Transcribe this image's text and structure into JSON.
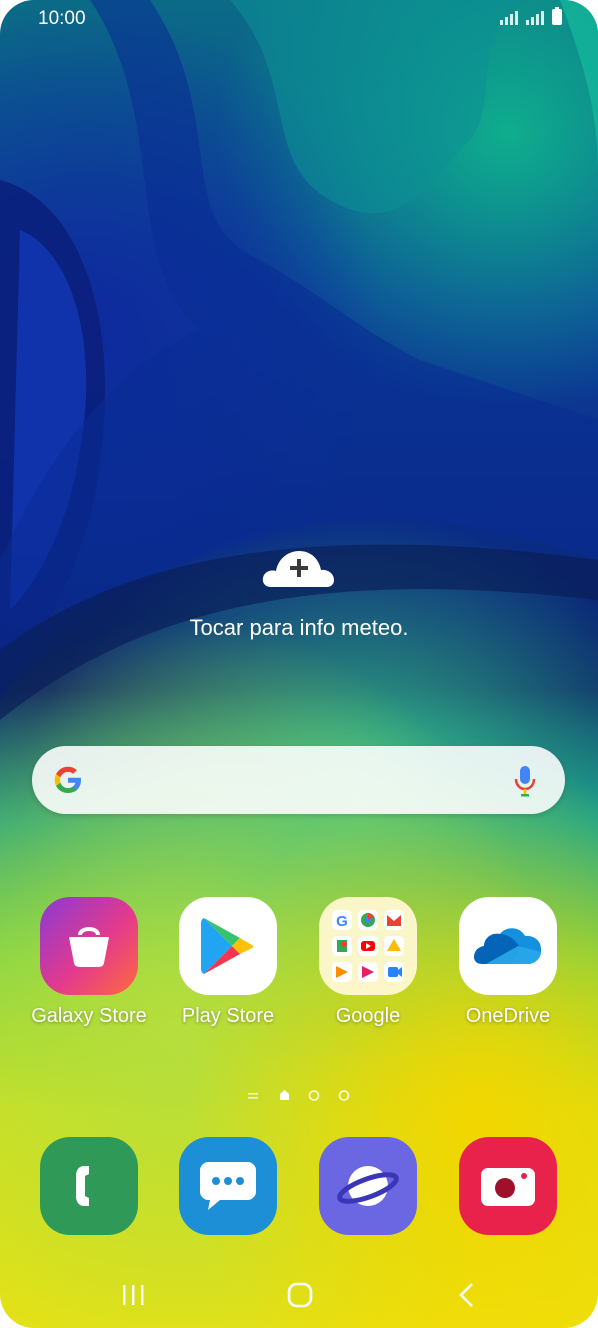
{
  "status_bar": {
    "time": "10:00"
  },
  "weather": {
    "label": "Tocar para info meteo.",
    "icon": "cloud-plus-icon"
  },
  "search": {
    "logo": "google-g-icon",
    "mic_icon": "mic-icon"
  },
  "apps": [
    {
      "label": "Galaxy Store",
      "icon": "galaxy-store-icon"
    },
    {
      "label": "Play Store",
      "icon": "play-store-icon"
    },
    {
      "label": "Google",
      "icon": "google-folder-icon"
    },
    {
      "label": "OneDrive",
      "icon": "onedrive-icon"
    }
  ],
  "page_indicator": {
    "pages": 3,
    "current": 1
  },
  "dock": [
    {
      "icon": "phone-icon"
    },
    {
      "icon": "messages-icon"
    },
    {
      "icon": "internet-icon"
    },
    {
      "icon": "camera-icon"
    }
  ],
  "nav": {
    "recent": "recent-apps-icon",
    "home": "home-icon",
    "back": "back-icon"
  },
  "colors": {
    "phone_green": "#2f9a58",
    "messages_blue": "#1c8fd6",
    "internet_purple": "#6b67e3",
    "camera_red": "#e8224a"
  }
}
